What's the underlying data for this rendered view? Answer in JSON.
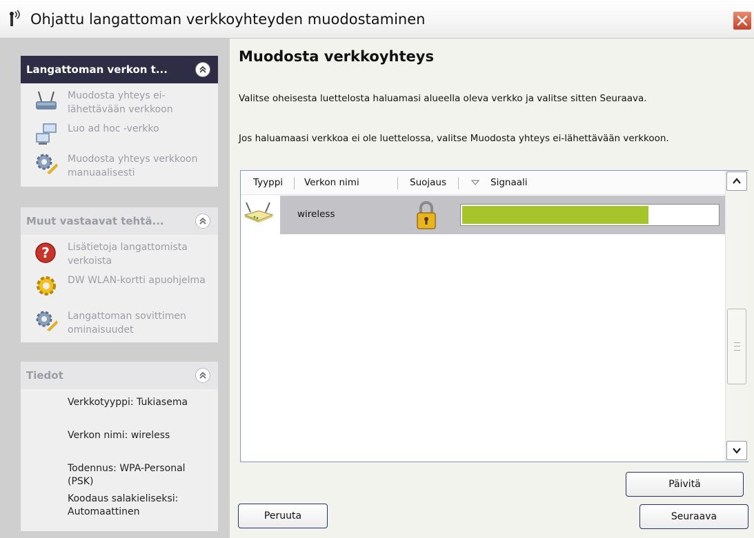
{
  "window": {
    "title": "Ohjattu langattoman verkkoyhteyden muodostaminen"
  },
  "sidebar": {
    "panel1": {
      "title": "Langattoman verkon t...",
      "items": [
        {
          "label": "Muodosta yhteys ei-lähettävään verkkoon",
          "icon": "router-icon"
        },
        {
          "label": "Luo ad hoc -verkko",
          "icon": "computers-icon"
        },
        {
          "label": "Muodosta yhteys verkkoon manuaalisesti",
          "icon": "gears-icon"
        }
      ]
    },
    "panel2": {
      "title": "Muut vastaavat tehtä...",
      "items": [
        {
          "label": "Lisätietoja langattomista verkoista",
          "icon": "help-icon"
        },
        {
          "label": "DW WLAN-kortti apuohjelma",
          "icon": "gear-icon"
        },
        {
          "label": "Langattoman sovittimen ominaisuudet",
          "icon": "gears-icon"
        }
      ]
    },
    "panel3": {
      "title": "Tiedot",
      "lines": [
        "Verkkotyyppi: Tukiasema",
        "Verkon nimi: wireless",
        "Todennus: WPA-Personal (PSK)",
        "Koodaus salakieliseksi: Automaattinen"
      ]
    }
  },
  "main": {
    "heading": "Muodosta verkkoyhteys",
    "instruction1": "Valitse oheisesta luettelosta haluamasi alueella oleva verkko ja valitse sitten Seuraava.",
    "instruction2": "Jos haluamaasi verkkoa ei ole luettelossa, valitse Muodosta yhteys ei-lähettävään verkkoon."
  },
  "list": {
    "columns": [
      "Tyyppi",
      "Verkon nimi",
      "Suojaus",
      "Signaali"
    ],
    "rows": [
      {
        "type_icon": "router-icon",
        "name": "wireless",
        "security_icon": "padlock-icon",
        "signal": 0.73
      }
    ]
  },
  "buttons": {
    "refresh": "Päivitä",
    "cancel": "Peruuta",
    "next": "Seuraava"
  },
  "colors": {
    "sidebar_bg": "#cfcfd0",
    "panel_dark": "#2e2d45",
    "signal_fill": "#a6c52a",
    "selection": "#c3c3c7",
    "close_red": "#c8412a"
  }
}
